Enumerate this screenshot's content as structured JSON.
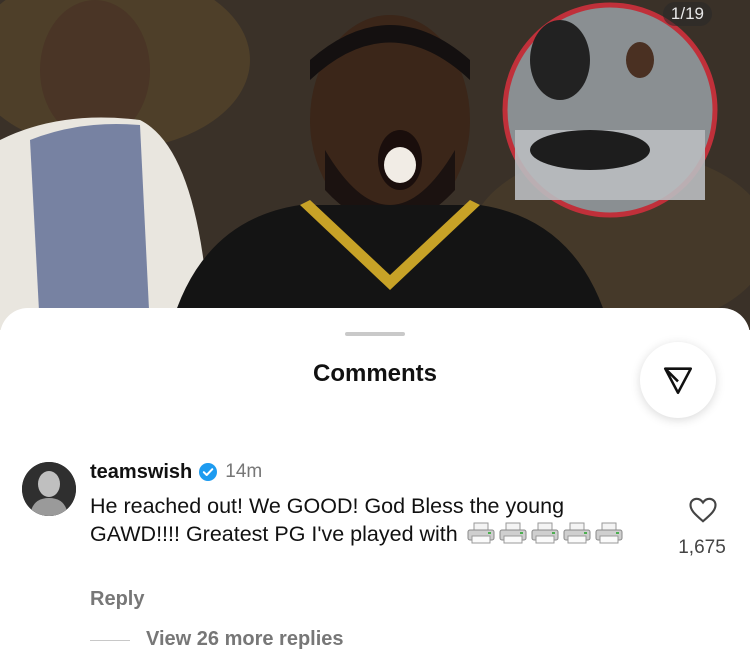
{
  "post": {
    "image_counter": "1/19"
  },
  "comments_sheet": {
    "title": "Comments",
    "share_icon": "send-icon"
  },
  "comment": {
    "username": "teamswish",
    "verified": true,
    "time": "14m",
    "text": "He reached out! We GOOD! God Bless the young GAWD!!!! Greatest PG I've played with",
    "emoji": "printer",
    "emoji_count": 5,
    "likes": "1,675",
    "reply_label": "Reply",
    "view_replies_label": "View 26 more replies"
  },
  "colors": {
    "verified_blue": "#1d9bf0",
    "muted_text": "#777777",
    "inset_ring": "#c0303a"
  }
}
